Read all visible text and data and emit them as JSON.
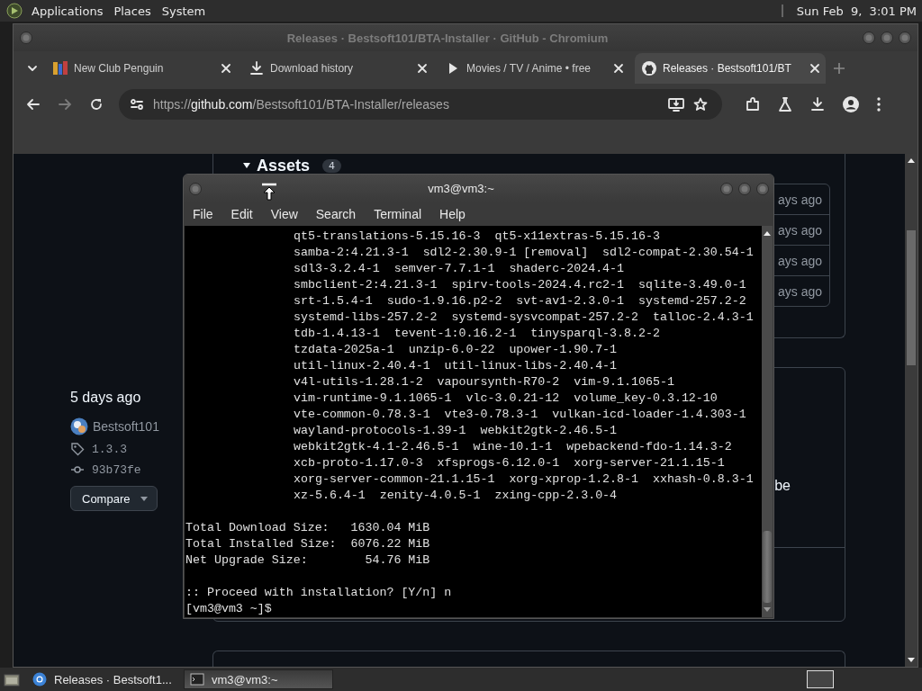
{
  "top_panel": {
    "menus": [
      "Applications",
      "Places",
      "System"
    ],
    "clock": "Sun Feb  9,  3:01 PM"
  },
  "browser": {
    "title": "Releases · Bestsoft101/BTA-Installer · GitHub - Chromium",
    "tabs": [
      {
        "label": "New Club Penguin",
        "kind": "game",
        "selected": false
      },
      {
        "label": "Download history",
        "kind": "download",
        "selected": false
      },
      {
        "label": "Movies / TV / Anime • free",
        "kind": "play",
        "selected": false
      },
      {
        "label": "Releases · Bestsoft101/BT",
        "kind": "github",
        "selected": true
      }
    ],
    "url": {
      "scheme": "https://",
      "host": "github.com",
      "path": "/Bestsoft101/BTA-Installer/releases"
    }
  },
  "page": {
    "assets": {
      "label": "Assets",
      "count": "4"
    },
    "asset_times": [
      "ays ago",
      "ays ago",
      "ays ago",
      "ays ago"
    ],
    "release": {
      "date": "5 days ago",
      "author": "Bestsoft101",
      "tag": "1.3.3",
      "commit": "93b73fe",
      "compare": "Compare"
    },
    "fragment": "be"
  },
  "terminal": {
    "title": "vm3@vm3:~",
    "menus": [
      "File",
      "Edit",
      "View",
      "Search",
      "Terminal",
      "Help"
    ],
    "packages": [
      "qt5-translations-5.15.16-3  qt5-x11extras-5.15.16-3",
      "samba-2:4.21.3-1  sdl2-2.30.9-1 [removal]  sdl2-compat-2.30.54-1",
      "sdl3-3.2.4-1  semver-7.7.1-1  shaderc-2024.4-1",
      "smbclient-2:4.21.3-1  spirv-tools-2024.4.rc2-1  sqlite-3.49.0-1",
      "srt-1.5.4-1  sudo-1.9.16.p2-2  svt-av1-2.3.0-1  systemd-257.2-2",
      "systemd-libs-257.2-2  systemd-sysvcompat-257.2-2  talloc-2.4.3-1",
      "tdb-1.4.13-1  tevent-1:0.16.2-1  tinysparql-3.8.2-2",
      "tzdata-2025a-1  unzip-6.0-22  upower-1.90.7-1",
      "util-linux-2.40.4-1  util-linux-libs-2.40.4-1",
      "v4l-utils-1.28.1-2  vapoursynth-R70-2  vim-9.1.1065-1",
      "vim-runtime-9.1.1065-1  vlc-3.0.21-12  volume_key-0.3.12-10",
      "vte-common-0.78.3-1  vte3-0.78.3-1  vulkan-icd-loader-1.4.303-1",
      "wayland-protocols-1.39-1  webkit2gtk-2.46.5-1",
      "webkit2gtk-4.1-2.46.5-1  wine-10.1-1  wpebackend-fdo-1.14.3-2",
      "xcb-proto-1.17.0-3  xfsprogs-6.12.0-1  xorg-server-21.1.15-1",
      "xorg-server-common-21.1.15-1  xorg-xprop-1.2.8-1  xxhash-0.8.3-1",
      "xz-5.6.4-1  zenity-4.0.5-1  zxing-cpp-2.3.0-4"
    ],
    "summary": [
      "Total Download Size:   1630.04 MiB",
      "Total Installed Size:  6076.22 MiB",
      "Net Upgrade Size:        54.76 MiB"
    ],
    "prompt": [
      ":: Proceed with installation? [Y/n] n",
      "[vm3@vm3 ~]$"
    ]
  },
  "taskbar": {
    "items": [
      {
        "label": "Releases · Bestsoft1...",
        "kind": "browser",
        "selected": false
      },
      {
        "label": "vm3@vm3:~",
        "kind": "terminal",
        "selected": true
      }
    ]
  }
}
